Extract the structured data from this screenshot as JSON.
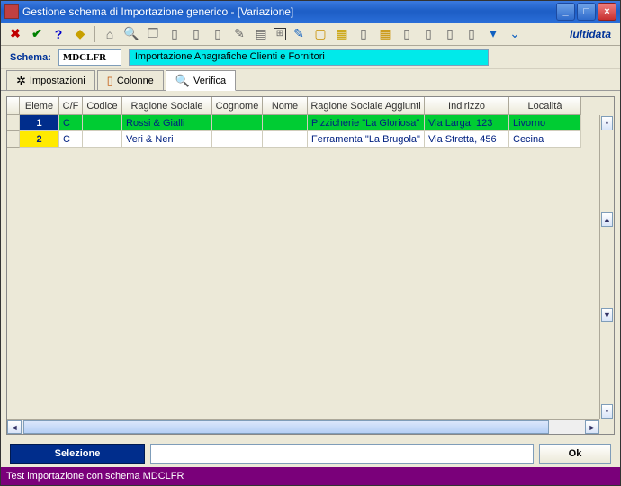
{
  "window": {
    "title": "Gestione schema di Importazione generico - [Variazione]"
  },
  "brand": "Iultidata",
  "schemabar": {
    "label": "Schema:",
    "value": "MDCLFR",
    "desc": "Importazione Anagrafiche Clienti e Fornitori"
  },
  "tabs": {
    "impostazioni": "Impostazioni",
    "colonne": "Colonne",
    "verifica": "Verifica"
  },
  "grid": {
    "headers": [
      "",
      "Eleme",
      "C/F",
      "Codice",
      "Ragione Sociale",
      "Cognome",
      "Nome",
      "Ragione Sociale Aggiunti",
      "Indirizzo",
      "Località"
    ],
    "rows": [
      {
        "num": "1",
        "cf": "C",
        "codice": "",
        "ragione": "Rossi & Gialli",
        "cognome": "",
        "nome": "",
        "ragagg": "Pizzicherie \"La Gloriosa\"",
        "indirizzo": "Via Larga, 123",
        "localita": "Livorno"
      },
      {
        "num": "2",
        "cf": "C",
        "codice": "",
        "ragione": "Veri & Neri",
        "cognome": "",
        "nome": "",
        "ragagg": "Ferramenta \"La Brugola\"",
        "indirizzo": "Via Stretta, 456",
        "localita": "Cecina"
      }
    ]
  },
  "buttons": {
    "selezione": "Selezione",
    "ok": "Ok"
  },
  "status": "Test importazione con schema MDCLFR"
}
